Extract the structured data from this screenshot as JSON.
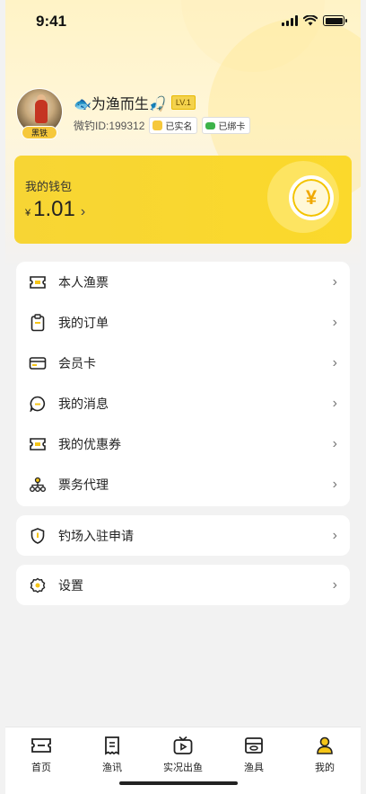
{
  "status_bar": {
    "time": "9:41"
  },
  "profile": {
    "nickname": "🐟为渔而生🎣",
    "level": "LV.1",
    "user_id": "微钓ID:199312",
    "rank": "黑铁",
    "verified": "已实名",
    "card_bound": "已绑卡"
  },
  "wallet": {
    "title": "我的钱包",
    "currency": "¥",
    "balance": "1.01",
    "coin_symbol": "¥"
  },
  "menu_group1": [
    {
      "label": "本人渔票",
      "icon": "ticket-icon"
    },
    {
      "label": "我的订单",
      "icon": "clipboard-icon"
    },
    {
      "label": "会员卡",
      "icon": "card-icon"
    },
    {
      "label": "我的消息",
      "icon": "chat-bubble-icon"
    },
    {
      "label": "我的优惠券",
      "icon": "coupon-icon"
    },
    {
      "label": "票务代理",
      "icon": "agent-network-icon"
    }
  ],
  "menu_group2": [
    {
      "label": "钓场入驻申请",
      "icon": "shield-icon"
    }
  ],
  "menu_group3": [
    {
      "label": "设置",
      "icon": "gear-icon"
    }
  ],
  "tabbar": [
    {
      "label": "首页",
      "icon": "home-ticket-icon",
      "active": false
    },
    {
      "label": "渔讯",
      "icon": "news-icon",
      "active": false
    },
    {
      "label": "实况出鱼",
      "icon": "live-video-icon",
      "active": false
    },
    {
      "label": "渔具",
      "icon": "tackle-box-icon",
      "active": false
    },
    {
      "label": "我的",
      "icon": "profile-icon",
      "active": true
    }
  ],
  "colors": {
    "accent": "#f7d534",
    "active_icon": "#f5c518",
    "page_bg": "#f2f2f2"
  }
}
